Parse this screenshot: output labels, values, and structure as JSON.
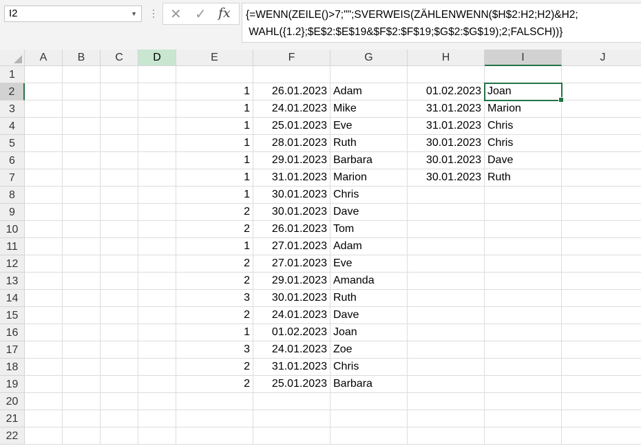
{
  "name_box": "I2",
  "formula": "{=WENN(ZEILE()>7;\"\";SVERWEIS(ZÄHLENWENN($H$2:H2;H2)&H2;\n WAHL({1.2};$E$2:$E$19&$F$2:$F$19;$G$2:$G$19);2;FALSCH))}",
  "columns": [
    "A",
    "B",
    "C",
    "D",
    "E",
    "F",
    "G",
    "H",
    "I",
    "J"
  ],
  "rows": [
    "1",
    "2",
    "3",
    "4",
    "5",
    "6",
    "7",
    "8",
    "9",
    "10",
    "11",
    "12",
    "13",
    "14",
    "15",
    "16",
    "17",
    "18",
    "19",
    "20",
    "21",
    "22"
  ],
  "col_e": [
    "1",
    "1",
    "1",
    "1",
    "1",
    "1",
    "1",
    "2",
    "2",
    "1",
    "2",
    "2",
    "3",
    "2",
    "1",
    "3",
    "2",
    "2"
  ],
  "col_f": [
    "26.01.2023",
    "24.01.2023",
    "25.01.2023",
    "28.01.2023",
    "29.01.2023",
    "31.01.2023",
    "30.01.2023",
    "30.01.2023",
    "26.01.2023",
    "27.01.2023",
    "27.01.2023",
    "29.01.2023",
    "30.01.2023",
    "24.01.2023",
    "01.02.2023",
    "24.01.2023",
    "31.01.2023",
    "25.01.2023"
  ],
  "col_g": [
    "Adam",
    "Mike",
    "Eve",
    "Ruth",
    "Barbara",
    "Marion",
    "Chris",
    "Dave",
    "Tom",
    "Adam",
    "Eve",
    "Amanda",
    "Ruth",
    "Dave",
    "Joan",
    "Zoe",
    "Chris",
    "Barbara"
  ],
  "col_h": [
    "01.02.2023",
    "31.01.2023",
    "31.01.2023",
    "30.01.2023",
    "30.01.2023",
    "30.01.2023"
  ],
  "col_i": [
    "Joan",
    "Marion",
    "Chris",
    "Chris",
    "Dave",
    "Ruth"
  ],
  "active_cell": {
    "column": "I",
    "row": 2
  },
  "highlighted_column": "D",
  "colors": {
    "accent": "#217346",
    "highlight_header": "#c8e6d0"
  }
}
